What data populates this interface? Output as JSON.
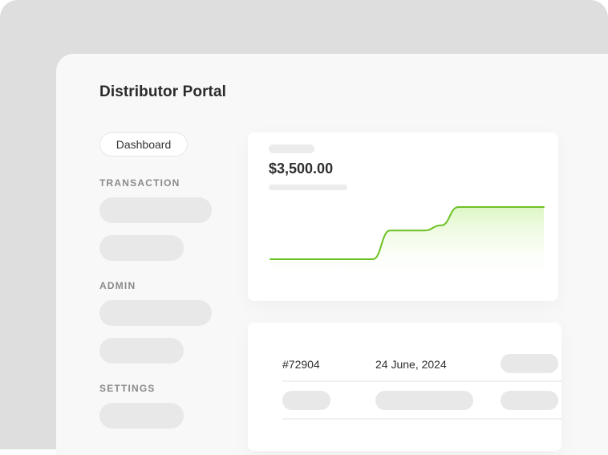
{
  "app": {
    "title": "Distributor Portal"
  },
  "sidebar": {
    "active_item": "Dashboard",
    "sections": [
      {
        "label": "TRANSACTION"
      },
      {
        "label": "ADMIN"
      },
      {
        "label": "SETTINGS"
      }
    ]
  },
  "summary_card": {
    "amount": "$3,500.00",
    "accent_color": "#6cc123"
  },
  "chart_data": {
    "type": "line",
    "title": "",
    "series": [
      {
        "values": [
          0,
          0,
          0,
          0,
          0,
          0,
          0,
          0.55,
          0.55,
          0.55,
          0.65,
          1,
          1,
          1,
          1,
          1,
          1
        ]
      }
    ],
    "ylim": [
      0,
      1
    ],
    "grid": false
  },
  "table": {
    "rows": [
      {
        "id": "#72904",
        "date": "24 June, 2024"
      }
    ]
  }
}
